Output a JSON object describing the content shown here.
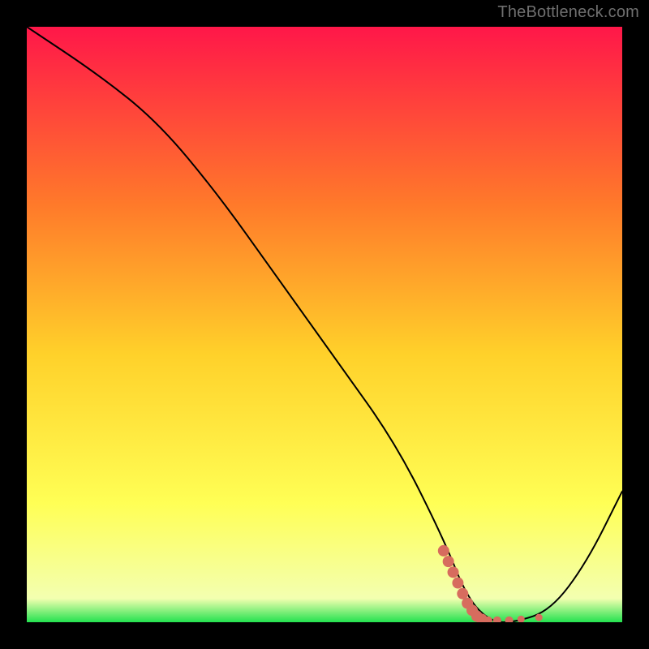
{
  "watermark": "TheBottleneck.com",
  "colors": {
    "background": "#000000",
    "gradient_top": "#ff1749",
    "gradient_mid1": "#ff7a2a",
    "gradient_mid2": "#ffd12a",
    "gradient_mid3": "#ffff55",
    "gradient_bottom": "#23e24f",
    "curve": "#000000",
    "marker": "#d76c5e"
  },
  "chart_data": {
    "type": "line",
    "title": "",
    "xlabel": "",
    "ylabel": "",
    "xlim": [
      0,
      100
    ],
    "ylim": [
      0,
      100
    ],
    "series": [
      {
        "name": "bottleneck-curve",
        "x": [
          0,
          12,
          22,
          32,
          42,
          52,
          62,
          70,
          74,
          78,
          82,
          88,
          94,
          100
        ],
        "y": [
          100,
          92,
          84,
          72,
          58,
          44,
          30,
          14,
          4,
          0,
          0,
          2,
          10,
          22
        ]
      }
    ],
    "optimal_region": {
      "x_start": 70,
      "x_end": 86,
      "y": 0
    },
    "markers": {
      "name": "optimal-points",
      "points": [
        {
          "x": 70.0,
          "y": 12.0
        },
        {
          "x": 70.8,
          "y": 10.2
        },
        {
          "x": 71.6,
          "y": 8.4
        },
        {
          "x": 72.4,
          "y": 6.6
        },
        {
          "x": 73.2,
          "y": 4.8
        },
        {
          "x": 74.0,
          "y": 3.2
        },
        {
          "x": 74.8,
          "y": 2.0
        },
        {
          "x": 75.6,
          "y": 1.0
        },
        {
          "x": 76.4,
          "y": 0.5
        },
        {
          "x": 77.5,
          "y": 0.3
        },
        {
          "x": 79.0,
          "y": 0.3
        },
        {
          "x": 81.0,
          "y": 0.3
        },
        {
          "x": 83.0,
          "y": 0.5
        },
        {
          "x": 86.0,
          "y": 0.8
        }
      ]
    }
  }
}
